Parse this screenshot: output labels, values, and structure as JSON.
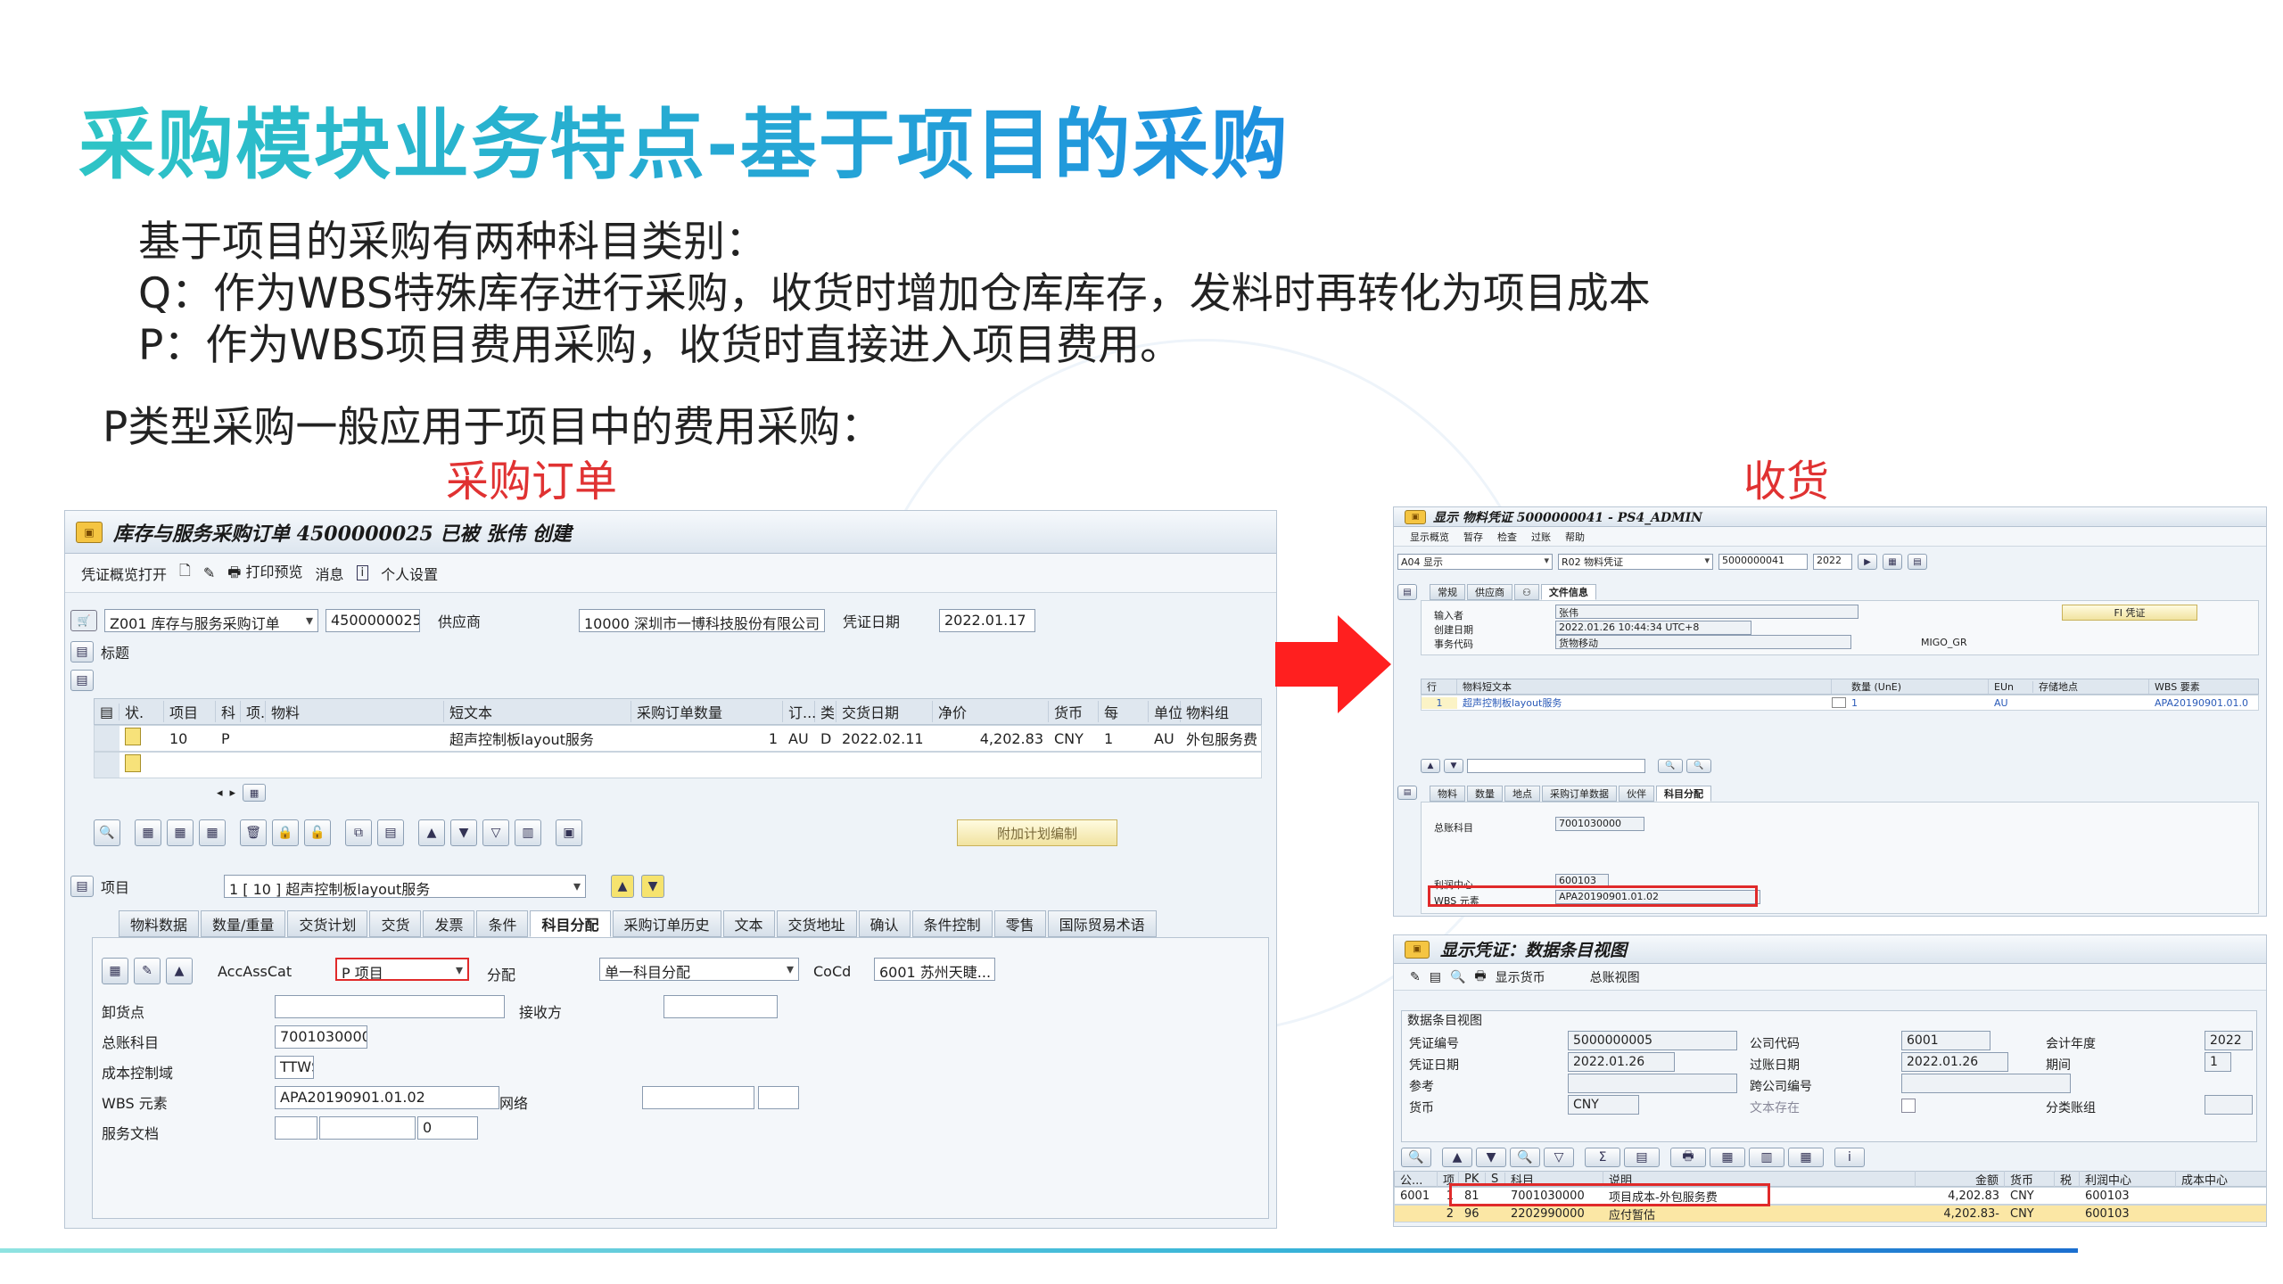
{
  "slide": {
    "title": "采购模块业务特点-基于项目的采购",
    "intro_lines": [
      "基于项目的采购有两种科目类别：",
      "Q：作为WBS特殊库存进行采购，收货时增加仓库库存，发料时再转化为项目成本",
      "P：作为WBS项目费用采购，收货时直接进入项目费用。"
    ],
    "p_type_line": "P类型采购一般应用于项目中的费用采购：",
    "label_po": "采购订单",
    "label_gr": "收货"
  },
  "po": {
    "title": "库存与服务采购订单 4500000025 已被 张伟 创建",
    "toolbar": [
      "凭证概览打开",
      "打印预览",
      "消息",
      "个人设置"
    ],
    "header": {
      "doc_type": "Z001 库存与服务采购订单",
      "po_number": "4500000025",
      "vendor_label": "供应商",
      "vendor": "10000 深圳市一博科技股份有限公司",
      "doc_date_label": "凭证日期",
      "doc_date": "2022.01.17",
      "header_label": "标题"
    },
    "grid": {
      "columns": [
        "状.",
        "项目",
        "科",
        "项.",
        "物料",
        "短文本",
        "采购订单数量",
        "订...",
        "类",
        "交货日期",
        "净价",
        "货币",
        "每",
        "单位",
        "物料组"
      ],
      "rows": [
        [
          "",
          "10",
          "P",
          "",
          "",
          "超声控制板layout服务",
          "1",
          "AU",
          "D",
          "2022.02.11",
          "4,202.83",
          "CNY",
          "1",
          "AU",
          "外包服务费"
        ]
      ]
    },
    "plan_button": "附加计划编制",
    "item_label": "项目",
    "item_value": "1 [ 10 ] 超声控制板layout服务",
    "tabs": [
      "物料数据",
      "数量/重量",
      "交货计划",
      "交货",
      "发票",
      "条件",
      "科目分配",
      "采购订单历史",
      "文本",
      "交货地址",
      "确认",
      "条件控制",
      "零售",
      "国际贸易术语"
    ],
    "active_tab": "科目分配",
    "acct": {
      "acc_label": "AccAssCat",
      "acc_value": "P 项目",
      "dist_label": "分配",
      "dist_value": "单一科目分配",
      "coco_label": "CoCd",
      "coco_value": "6001 苏州天睫...",
      "unload_label": "卸货点",
      "recipient_label": "接收方",
      "gl_label": "总账科目",
      "gl_value": "7001030000",
      "ca_label": "成本控制域",
      "ca_value": "TTWS",
      "wbs_label": "WBS 元素",
      "wbs_value": "APA20190901.01.02",
      "network_label": "网络",
      "svc_label": "服务文档",
      "svc_value": "0"
    }
  },
  "gr": {
    "title": "显示 物料凭证 5000000041 - PS4_ADMIN",
    "toolbar": [
      "显示概览",
      "暂存",
      "检查",
      "过账",
      "帮助"
    ],
    "mode": "A04 显示",
    "type": "R02 物料凭证",
    "doc_no": "5000000041",
    "year": "2022",
    "tabs": [
      "常规",
      "供应商",
      "",
      "文件信息"
    ],
    "fi_button": "FI 凭证",
    "input_label": "输入者",
    "input_value": "张伟",
    "created_label": "创建日期",
    "created_value": "2022.01.26  10:44:34  UTC+8",
    "tcode_label": "事务代码",
    "tcode_value": "货物移动",
    "tcode_extra": "MIGO_GR",
    "grid_columns": [
      "行",
      "物料短文本",
      "",
      "数量 (UnE)",
      "EUn",
      "存储地点",
      "WBS 要素"
    ],
    "grid_row": [
      "1",
      "超声控制板layout服务",
      "",
      "1",
      "AU",
      "",
      "APA20190901.01.0"
    ],
    "detail_tabs": [
      "物料",
      "数量",
      "地点",
      "采购订单数据",
      "伙伴",
      "科目分配"
    ],
    "gl_label": "总账科目",
    "gl_value": "7001030000",
    "pc_label": "利润中心",
    "pc_value": "600103",
    "wbs_label": "WBS 元素",
    "wbs_value": "APA20190901.01.02"
  },
  "fi": {
    "title": "显示凭证：数据条目视图",
    "toolbar": [
      "显示货币",
      "总账视图"
    ],
    "section": "数据条目视图",
    "fields": {
      "doc_no_label": "凭证编号",
      "doc_no": "5000000005",
      "cocode_label": "公司代码",
      "cocode": "6001",
      "fy_label": "会计年度",
      "fy": "2022",
      "doc_date_label": "凭证日期",
      "doc_date": "2022.01.26",
      "post_date_label": "过账日期",
      "post_date": "2022.01.26",
      "period_label": "期间",
      "period": "1",
      "ref_label": "参考",
      "ref": "",
      "cross_label": "跨公司编号",
      "cross": "",
      "cur_label": "货币",
      "cur": "CNY",
      "text_label": "文本存在",
      "ledger_label": "分类账组"
    },
    "columns": [
      "公...",
      "项",
      "PK",
      "S",
      "科目",
      "说明",
      "金额",
      "货币",
      "税",
      "利润中心",
      "成本中心"
    ],
    "rows": [
      [
        "6001",
        "1",
        "81",
        "",
        "7001030000",
        "项目成本-外包服务费",
        "4,202.83",
        "CNY",
        "",
        "600103",
        ""
      ],
      [
        "",
        "2",
        "96",
        "",
        "2202990000",
        "应付暂估",
        "4,202.83-",
        "CNY",
        "",
        "600103",
        ""
      ]
    ]
  },
  "colors": {
    "title_gradient_start": "#2ec4c6",
    "title_gradient_end": "#1e90e0",
    "highlight_red": "#e02a2a",
    "arrow_red": "#ff1f1f"
  }
}
